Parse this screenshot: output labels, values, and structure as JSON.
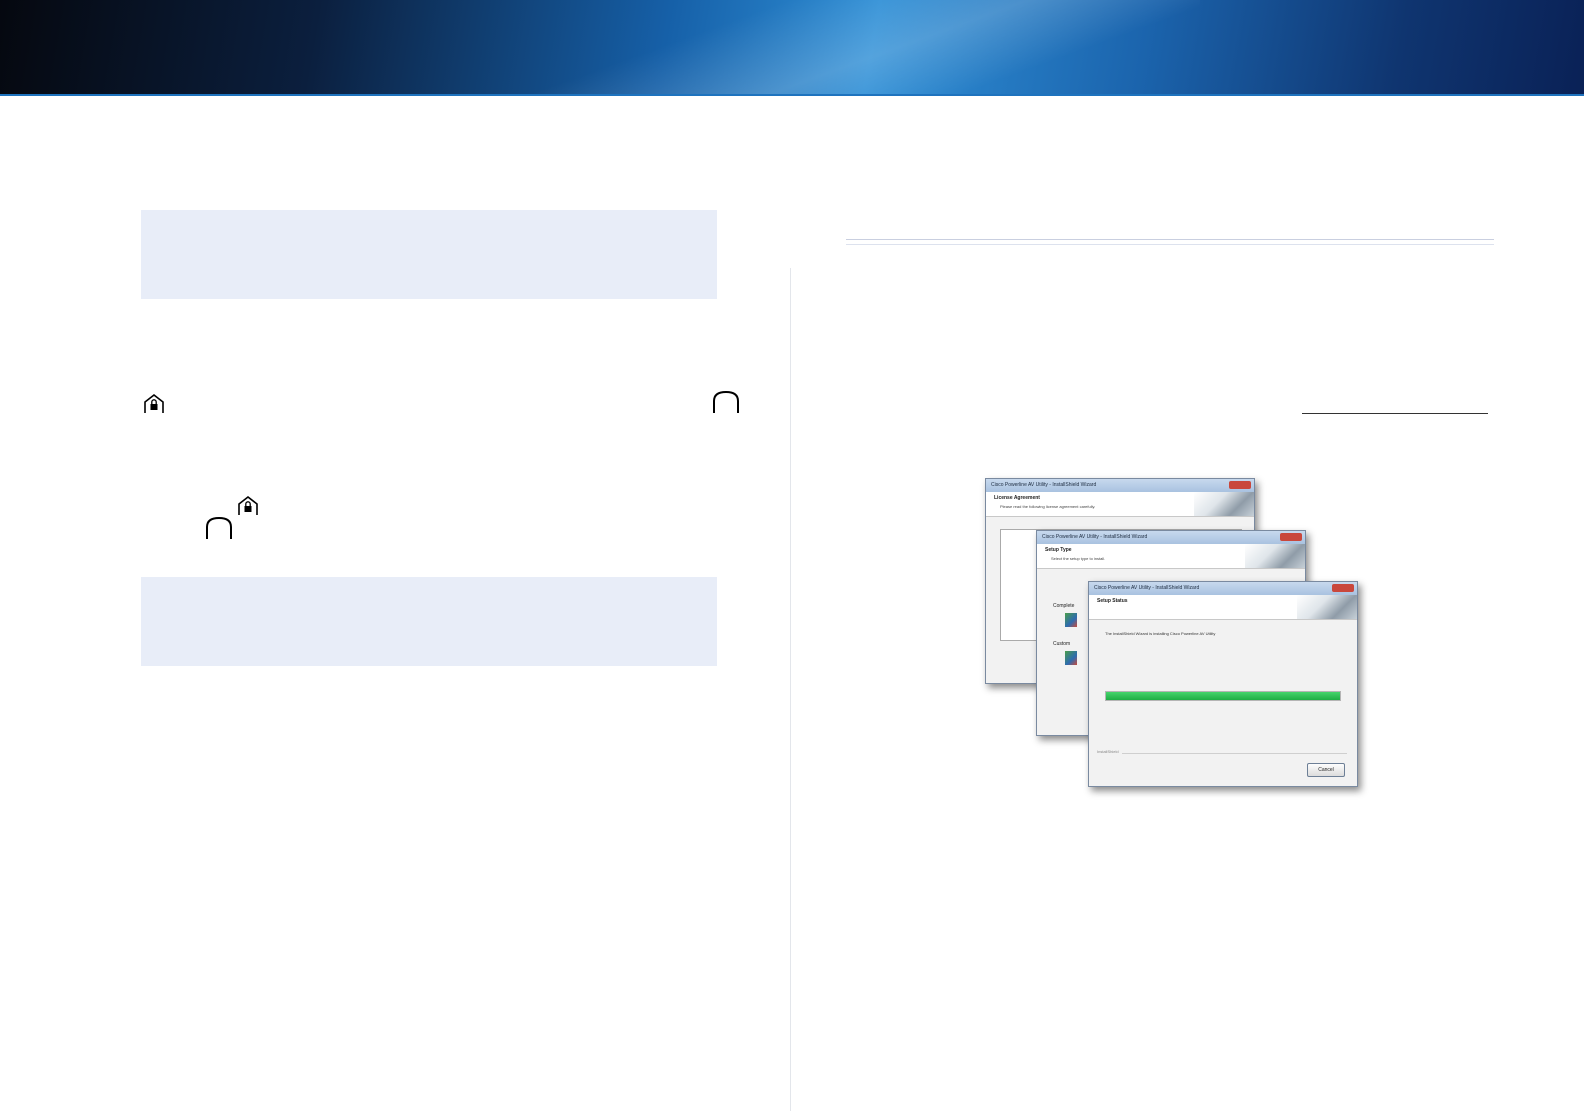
{
  "header": {
    "accent_color": "#1e73be"
  },
  "icons": {
    "lock_home": "lock-home-icon",
    "arch": "arch-icon"
  },
  "note_box_color": "#e8edf8",
  "wizard_screens": {
    "window1": {
      "title": "Cisco Powerline AV Utility - InstallShield Wizard",
      "heading": "License Agreement",
      "subheading": "Please read the following license agreement carefully."
    },
    "window2": {
      "title": "Cisco Powerline AV Utility - InstallShield Wizard",
      "heading": "Setup Type",
      "subheading": "Select the setup type to install.",
      "option_complete": "Complete",
      "option_custom": "Custom"
    },
    "window3": {
      "title": "Cisco Powerline AV Utility - InstallShield Wizard",
      "heading": "Setup Status",
      "status_text": "The InstallShield Wizard is installing Cisco Powerline AV Utility",
      "progress_percent": 100,
      "footer": "InstallShield",
      "cancel_label": "Cancel"
    }
  }
}
